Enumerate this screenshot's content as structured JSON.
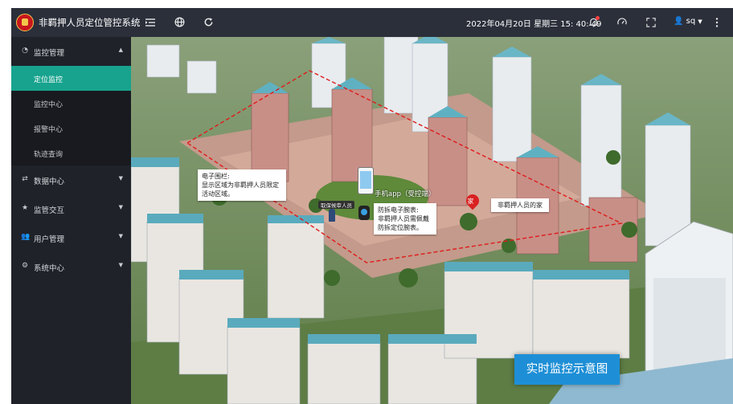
{
  "header": {
    "app_title": "非羁押人员定位管控系统",
    "datetime": "2022年04月20日 星期三 15: 40: 49",
    "username": "sq"
  },
  "sidebar": {
    "groups": [
      {
        "label": "监控管理",
        "icon": "dashboard-icon",
        "expanded": true,
        "items": [
          {
            "label": "定位监控",
            "active": true
          },
          {
            "label": "监控中心",
            "active": false
          },
          {
            "label": "报警中心",
            "active": false
          },
          {
            "label": "轨迹查询",
            "active": false
          }
        ]
      },
      {
        "label": "数据中心",
        "icon": "shuffle-icon",
        "expanded": false
      },
      {
        "label": "监管交互",
        "icon": "star-icon",
        "expanded": false
      },
      {
        "label": "用户管理",
        "icon": "users-icon",
        "expanded": false
      },
      {
        "label": "系统中心",
        "icon": "settings-icon",
        "expanded": false
      }
    ]
  },
  "map": {
    "fence_callout_title": "电子围栏:",
    "fence_callout_text": "显示区域为非羁押人员限定活动区域。",
    "phone_app_label": "手机app（受控端）",
    "person_badge": "取保候审人员",
    "bracelet_callout_title": "防拆电子腕表:",
    "bracelet_callout_text": "非羁押人员需佩戴防拆定位腕表。",
    "home_marker": "家",
    "home_callout": "非羁押人员的家",
    "banner": "实时监控示意图"
  },
  "colors": {
    "topbar": "#2b2f3a",
    "sidebar": "#1f2229",
    "active_item": "#17a38e",
    "banner": "#1e8fd6",
    "fence_line": "#e01b1b"
  }
}
